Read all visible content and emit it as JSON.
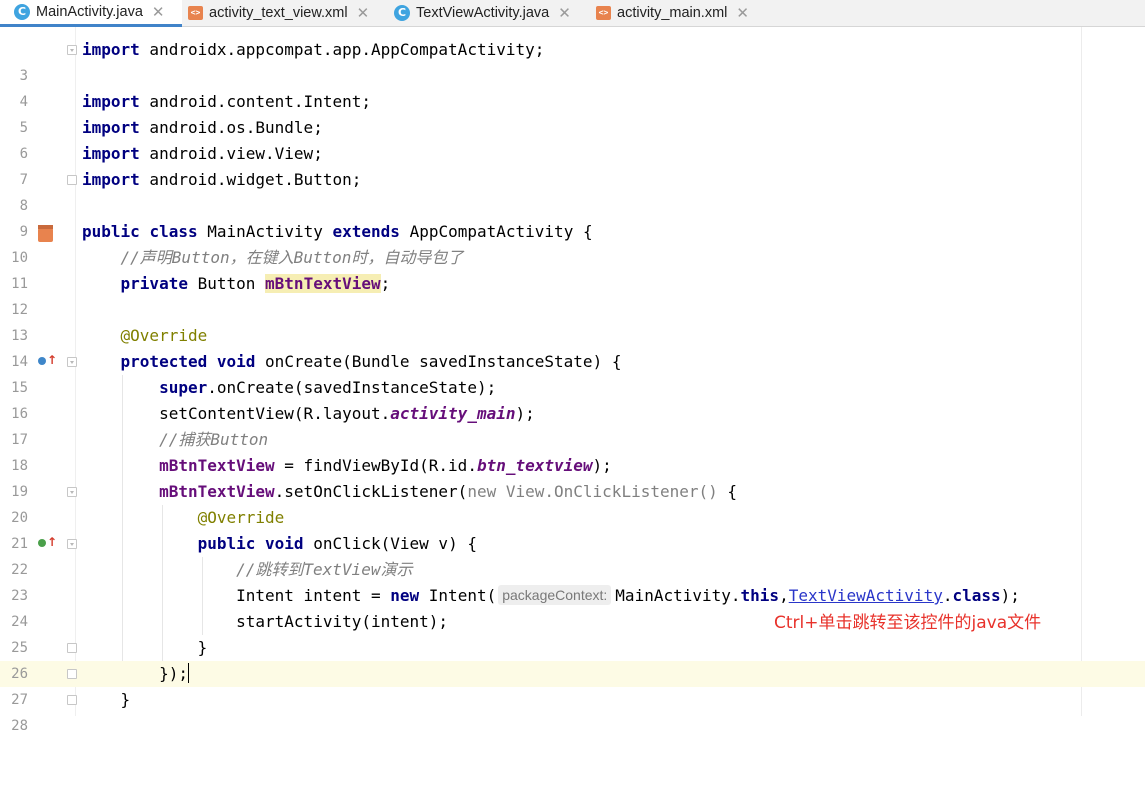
{
  "tabs": [
    {
      "label": "MainActivity.java",
      "type": "java",
      "active": true
    },
    {
      "label": "activity_text_view.xml",
      "type": "xml",
      "active": false
    },
    {
      "label": "TextViewActivity.java",
      "type": "java",
      "active": false
    },
    {
      "label": "activity_main.xml",
      "type": "xml",
      "active": false
    }
  ],
  "close_glyph": "✕",
  "editor": {
    "line_numbers": [
      "3",
      "4",
      "5",
      "6",
      "7",
      "8",
      "9",
      "10",
      "11",
      "12",
      "13",
      "14",
      "15",
      "16",
      "17",
      "18",
      "19",
      "20",
      "21",
      "22",
      "23",
      "24",
      "25",
      "26",
      "27",
      "28"
    ],
    "code": {
      "l3": {
        "kw": "import",
        "text": " androidx.appcompat.app.AppCompatActivity;"
      },
      "l5": {
        "kw": "import",
        "text": " android.content.Intent;"
      },
      "l6": {
        "kw": "import",
        "text": " android.os.Bundle;"
      },
      "l7": {
        "kw": "import",
        "text": " android.view.View;"
      },
      "l8": {
        "kw": "import",
        "text": " android.widget.Button;"
      },
      "l10": {
        "kw1": "public",
        "kw2": "class",
        "name": "MainActivity",
        "kw3": "extends",
        "rest": "AppCompatActivity {"
      },
      "l11": {
        "comment": "//声明Button，在键入Button时，自动导包了"
      },
      "l12": {
        "kw": "private",
        "type": " Button ",
        "field": "mBtnTextView",
        "end": ";"
      },
      "l14": {
        "ann": "@Override"
      },
      "l15": {
        "kw1": "protected",
        "kw2": "void",
        "rest": "onCreate(Bundle savedInstanceState) {"
      },
      "l16": {
        "kw": "super",
        "rest": ".onCreate(savedInstanceState);"
      },
      "l17": {
        "pre": "setContentView(R.layout.",
        "field": "activity_main",
        "end": ");"
      },
      "l18": {
        "comment": "//捕获Button"
      },
      "l19": {
        "field": "mBtnTextView",
        "mid": " = findViewById(R.id.",
        "field2": "btn_textview",
        "end": ");"
      },
      "l20": {
        "field": "mBtnTextView",
        "mid": ".setOnClickListener(",
        "gray": "new View.OnClickListener()",
        "end": " {"
      },
      "l21": {
        "ann": "@Override"
      },
      "l22": {
        "kw1": "public",
        "kw2": "void",
        "rest": "onClick(View v) {"
      },
      "l23": {
        "comment": "//跳转到TextView演示"
      },
      "l24": {
        "pre": "Intent intent = ",
        "kw": "new",
        "mid": " Intent(",
        "hint": "packageContext:",
        "cls": "MainActivity.",
        "kw2": "this",
        "comma": ",",
        "link": "TextViewActivity",
        "dot": ".",
        "kw3": "class",
        "end": ");"
      },
      "l25": {
        "text": "startActivity(intent);"
      },
      "l26": {
        "text": "}"
      },
      "l27": {
        "text": "});"
      },
      "l28": {
        "text": "}"
      }
    }
  },
  "annotation": "Ctrl+单击跳转至该控件的java文件",
  "gutter_icons": {
    "line10": "xml-layout-icon",
    "line15": "override-icon",
    "line22": "implement-icon"
  },
  "colors": {
    "keyword": "#000080",
    "field": "#660e7a",
    "comment": "#808080",
    "annotation_red": "#e8322b",
    "tab_underline": "#4083c9"
  }
}
